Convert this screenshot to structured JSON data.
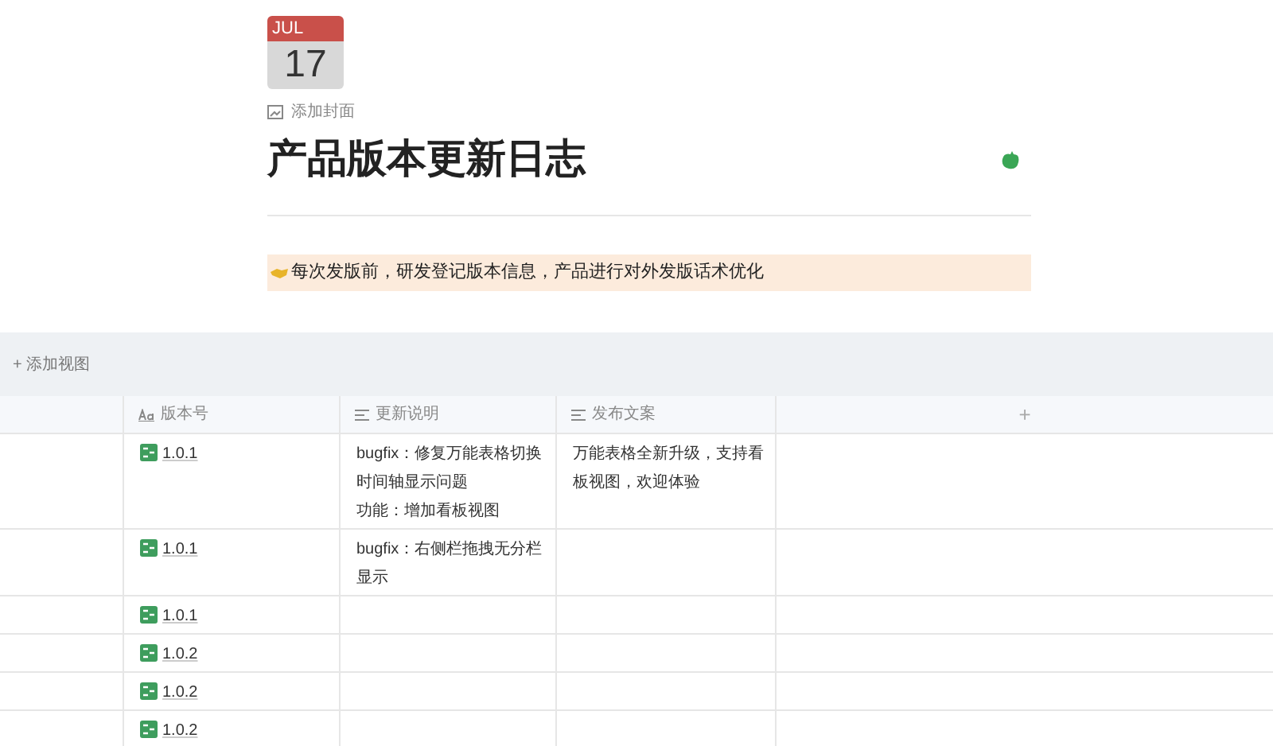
{
  "page_icon": {
    "month": "JUL",
    "day": "17"
  },
  "add_cover": "添加封面",
  "title": "产品版本更新日志",
  "callout": {
    "text": "每次发版前，研发登记版本信息，产品进行对外发版话术优化"
  },
  "toolbar": {
    "add_view": "+ 添加视图"
  },
  "table": {
    "columns": [
      {
        "label": "版本号",
        "kind": "title"
      },
      {
        "label": "更新说明",
        "kind": "text"
      },
      {
        "label": "发布文案",
        "kind": "text"
      }
    ],
    "add_column": "+",
    "rows": [
      {
        "version": "1.0.1",
        "notes": [
          "bugfix：修复万能表格切换时间轴显示问题",
          "功能：增加看板视图"
        ],
        "copy": "万能表格全新升级，支持看板视图，欢迎体验"
      },
      {
        "version": "1.0.1",
        "notes": [
          "bugfix：右侧栏拖拽无分栏显示"
        ],
        "copy": ""
      },
      {
        "version": "1.0.1",
        "notes": [],
        "copy": ""
      },
      {
        "version": "1.0.2",
        "notes": [],
        "copy": ""
      },
      {
        "version": "1.0.2",
        "notes": [],
        "copy": ""
      },
      {
        "version": "1.0.2",
        "notes": [],
        "copy": ""
      }
    ]
  }
}
